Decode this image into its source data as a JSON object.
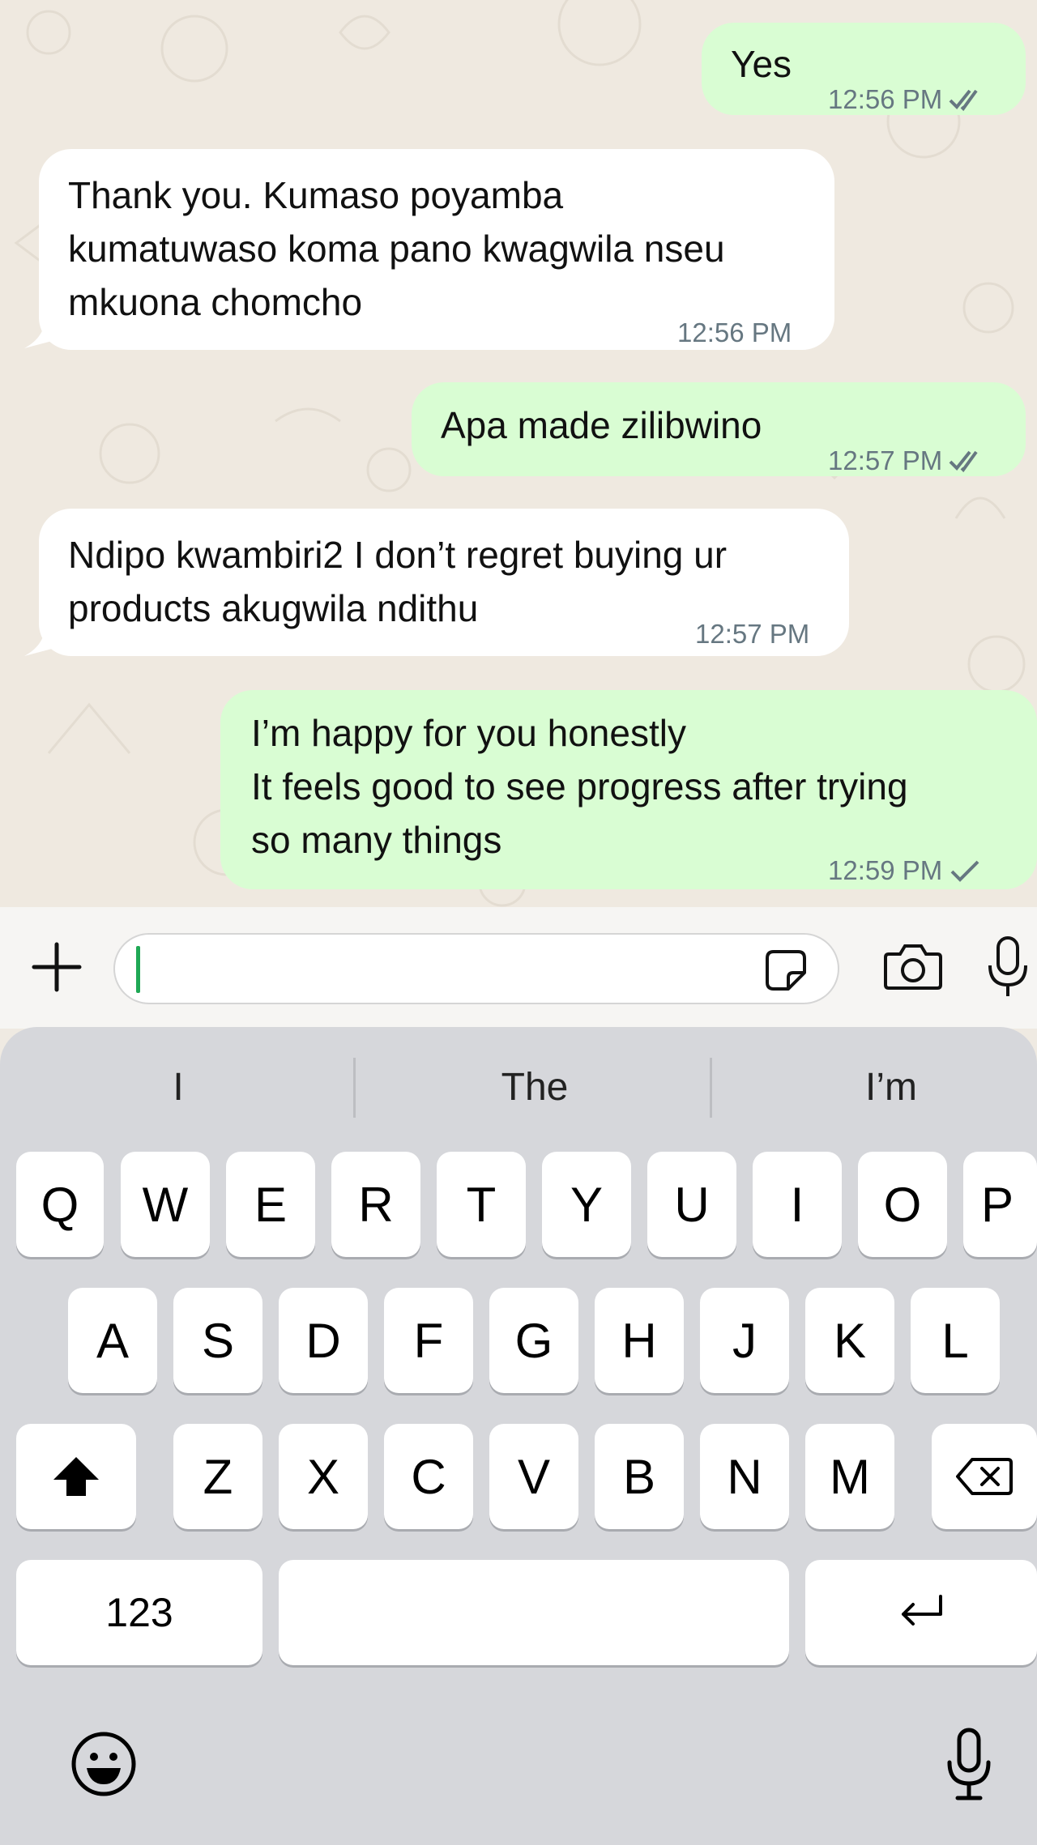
{
  "messages": [
    {
      "direction": "outgoing",
      "text": "Yes",
      "time": "12:56 PM",
      "status": "read-double-check"
    },
    {
      "direction": "incoming",
      "text": "Thank you.  Kumaso poyamba\nkumatuwaso koma pano kwagwila nseu\nmkuona chomcho",
      "time": "12:56 PM"
    },
    {
      "direction": "outgoing",
      "text": "Apa made zilibwino",
      "time": "12:57 PM",
      "status": "read-double-check"
    },
    {
      "direction": "incoming",
      "text": "Ndipo kwambiri2 I don’t regret buying ur\nproducts akugwila ndithu",
      "time": "12:57 PM"
    },
    {
      "direction": "outgoing",
      "text": "I’m happy for you honestly\nIt feels good to see progress after trying\nso many things",
      "time": "12:59 PM",
      "status": "sent-single-check"
    }
  ],
  "composer": {
    "input_value": "",
    "icons": [
      "plus-icon",
      "sticker-icon",
      "camera-icon",
      "microphone-icon"
    ]
  },
  "keyboard": {
    "suggestions": [
      "I",
      "The",
      "I’m"
    ],
    "row1": [
      "Q",
      "W",
      "E",
      "R",
      "T",
      "Y",
      "U",
      "I",
      "O",
      "P"
    ],
    "row2": [
      "A",
      "S",
      "D",
      "F",
      "G",
      "H",
      "J",
      "K",
      "L"
    ],
    "row3": [
      "Z",
      "X",
      "C",
      "V",
      "B",
      "N",
      "M"
    ],
    "numbers_key": "123",
    "icons": [
      "shift-icon",
      "backspace-icon",
      "return-icon",
      "emoji-icon",
      "dictation-icon"
    ]
  },
  "colors": {
    "outgoing_bubble": "#d9fdd3",
    "incoming_bubble": "#ffffff",
    "chat_background": "#efe9e0",
    "caret": "#1fa855",
    "keyboard_bg": "#d6d7db"
  }
}
